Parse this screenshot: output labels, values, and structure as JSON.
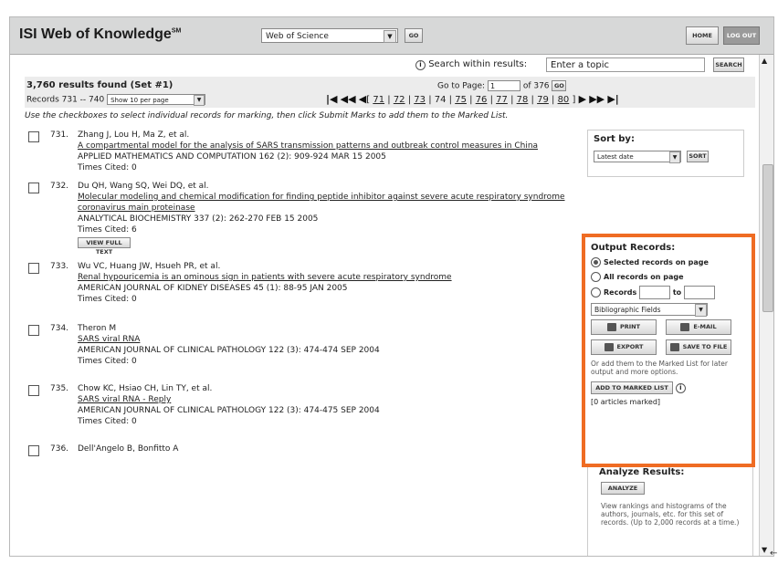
{
  "header": {
    "logo": "ISI Web of Knowledge",
    "logo_sup": "SM",
    "database": "Web of Science",
    "go_label": "GO",
    "home_label": "HOME",
    "logout_label": "LOG OUT"
  },
  "search": {
    "label": "Search within results:",
    "placeholder": "Enter a topic",
    "button": "SEARCH"
  },
  "results": {
    "found": "3,760 results found (Set #1)",
    "records_range": "Records 731 -- 740",
    "per_page": "Show 10 per page",
    "goto_label": "Go to Page:",
    "goto_value": "1",
    "of_pages": "of 376",
    "goto_btn": "GO",
    "pages": [
      "71",
      "72",
      "73",
      "74",
      "75",
      "76",
      "77",
      "78",
      "79",
      "80"
    ],
    "current_page": "74"
  },
  "instructions": "Use the checkboxes to select individual records for marking, then click Submit Marks to add them to the Marked List.",
  "records": [
    {
      "num": "731.",
      "authors": "Zhang J, Lou H, Ma Z, et al.",
      "title": "A compartmental model for the analysis of SARS transmission patterns and outbreak control measures in China",
      "source": "APPLIED MATHEMATICS AND COMPUTATION 162 (2): 909-924 MAR 15 2005",
      "cited": "Times Cited: 0",
      "fulltext": ""
    },
    {
      "num": "732.",
      "authors": "Du QH, Wang SQ, Wei DQ, et al.",
      "title": "Molecular modeling and chemical modification for finding peptide inhibitor against severe acute respiratory syndrome coronavirus main proteinase",
      "source": "ANALYTICAL BIOCHEMISTRY 337 (2): 262-270 FEB 15 2005",
      "cited": "Times Cited: 6",
      "fulltext": "VIEW FULL TEXT"
    },
    {
      "num": "733.",
      "authors": "Wu VC, Huang JW, Hsueh PR, et al.",
      "title": "Renal hypouricemia is an ominous sign in patients with severe acute respiratory syndrome",
      "source": "AMERICAN JOURNAL OF KIDNEY DISEASES 45 (1): 88-95 JAN 2005",
      "cited": "Times Cited: 0",
      "fulltext": ""
    },
    {
      "num": "734.",
      "authors": "Theron M",
      "title": "SARS viral RNA",
      "source": "AMERICAN JOURNAL OF CLINICAL PATHOLOGY 122 (3): 474-474 SEP 2004",
      "cited": "Times Cited: 0",
      "fulltext": ""
    },
    {
      "num": "735.",
      "authors": "Chow KC, Hsiao CH, Lin TY, et al.",
      "title": "SARS viral RNA - Reply",
      "source": "AMERICAN JOURNAL OF CLINICAL PATHOLOGY 122 (3): 474-475 SEP 2004",
      "cited": "Times Cited: 0",
      "fulltext": ""
    },
    {
      "num": "736.",
      "authors": "Dell'Angelo B, Bonfitto A",
      "title": "",
      "source": "",
      "cited": "",
      "fulltext": ""
    }
  ],
  "sort": {
    "label": "Sort by:",
    "selected": "Latest date",
    "button": "SORT"
  },
  "output": {
    "title": "Output Records:",
    "opt_selected": "Selected records on page",
    "opt_all": "All records on page",
    "opt_records": "Records",
    "opt_to": "to",
    "fields": "Bibliographic Fields",
    "print": "PRINT",
    "email": "E-MAIL",
    "export": "EXPORT",
    "save": "SAVE TO FILE",
    "note": "Or add them to the Marked List for later output and more options.",
    "add_marked": "ADD TO MARKED LIST",
    "marked_count": "[0 articles marked]"
  },
  "analyze": {
    "title": "Analyze Results:",
    "button": "ANALYZE",
    "note": "View rankings and histograms of the authors, journals, etc. for this set of records. (Up to 2,000 records at a time.)"
  },
  "colors": {
    "highlight": "#ef6c23",
    "header_bg": "#d7d8d8"
  }
}
